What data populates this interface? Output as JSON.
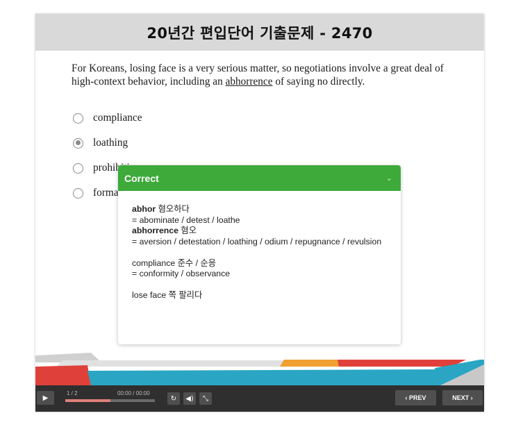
{
  "header": {
    "title": "20년간 편입단어 기출문제 - 2470"
  },
  "question": {
    "text_before": "For Koreans, losing face is a very serious matter, so negotiations involve a great deal of high-context behavior, including an ",
    "underlined": "abhorrence",
    "text_after": " of saying no directly."
  },
  "options": [
    {
      "label": "compliance",
      "selected": false
    },
    {
      "label": "loathing",
      "selected": true
    },
    {
      "label": "prohibition",
      "selected": false
    },
    {
      "label": "formality",
      "selected": false
    }
  ],
  "feedback": {
    "title": "Correct",
    "header_color": "#3daa3a",
    "w1_bold": "abhor",
    "w1_meaning": " 혐오하다",
    "w1_syn": "= abominate / detest / loathe",
    "w2_bold": "abhorrence",
    "w2_meaning": " 혐오",
    "w2_syn": "= aversion / detestation / loathing / odium / repugnance / revulsion",
    "w3_line": "compliance 준수 / 순응",
    "w3_syn": "= conformity / observance",
    "w4_line": "lose face 쪽 팔리다"
  },
  "player": {
    "slide_counter": "1 / 2",
    "time": "00:00 / 00:00",
    "progress": 0.5,
    "prev_label": "‹ PREV",
    "next_label": "NEXT ›",
    "icons": [
      "play-icon",
      "replay-icon",
      "volume-icon",
      "fullscreen-icon"
    ]
  },
  "colors": {
    "title_bar": "#d9d9d9",
    "deco_red": "#e0403a",
    "deco_blue": "#2aa6c4",
    "deco_orange": "#f0a030",
    "deco_gray": "#d0d0d0",
    "control_bar": "#2f2f2f"
  }
}
